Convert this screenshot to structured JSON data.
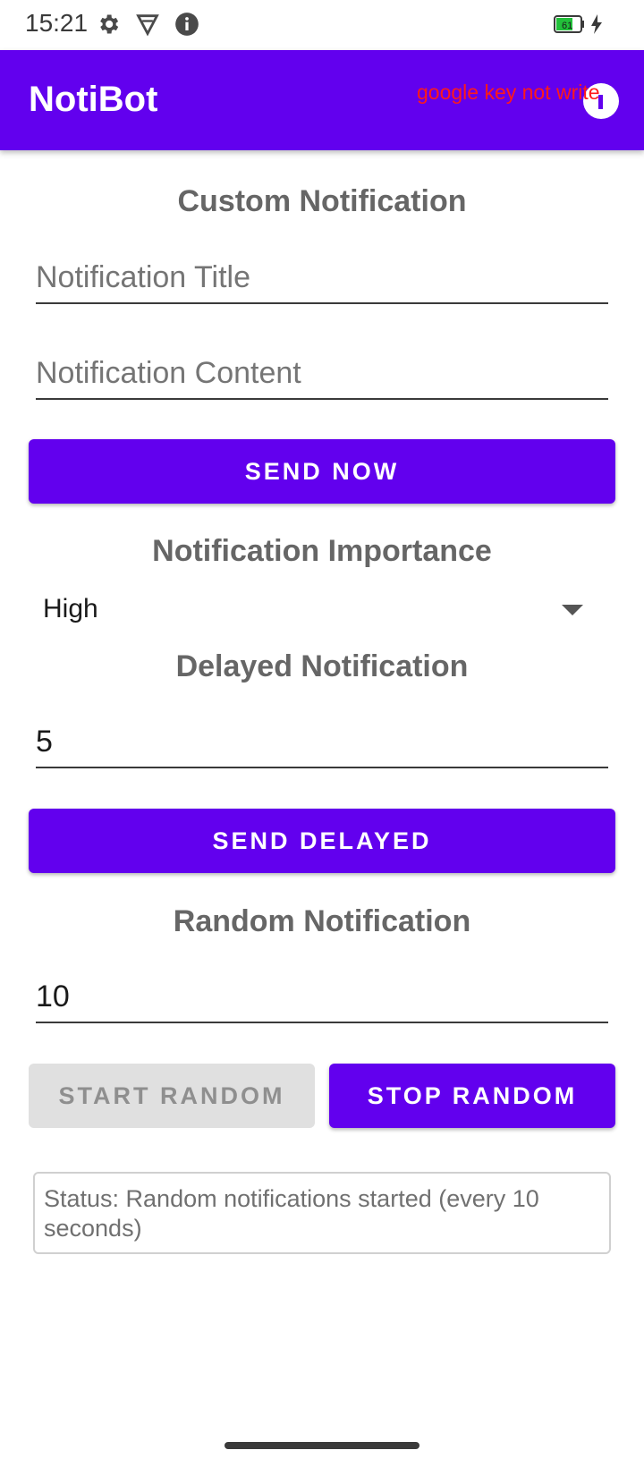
{
  "status_bar": {
    "time": "15:21",
    "icons": [
      "gear-icon",
      "vpn-shield-icon",
      "info-icon"
    ],
    "battery_level": "61"
  },
  "app_bar": {
    "title": "NotiBot",
    "warning": "google key not write",
    "colors": {
      "primary": "#6200ee",
      "warning": "#ff1a1a"
    }
  },
  "custom": {
    "heading": "Custom Notification",
    "title_placeholder": "Notification Title",
    "content_placeholder": "Notification Content",
    "send_now_label": "SEND NOW"
  },
  "importance": {
    "heading": "Notification Importance",
    "selected": "High"
  },
  "delayed": {
    "heading": "Delayed Notification",
    "value": "5",
    "send_label": "SEND DELAYED"
  },
  "random": {
    "heading": "Random Notification",
    "value": "10",
    "start_label": "START RANDOM",
    "stop_label": "STOP RANDOM"
  },
  "status": {
    "text": "Status: Random notifications started (every 10 seconds)"
  }
}
